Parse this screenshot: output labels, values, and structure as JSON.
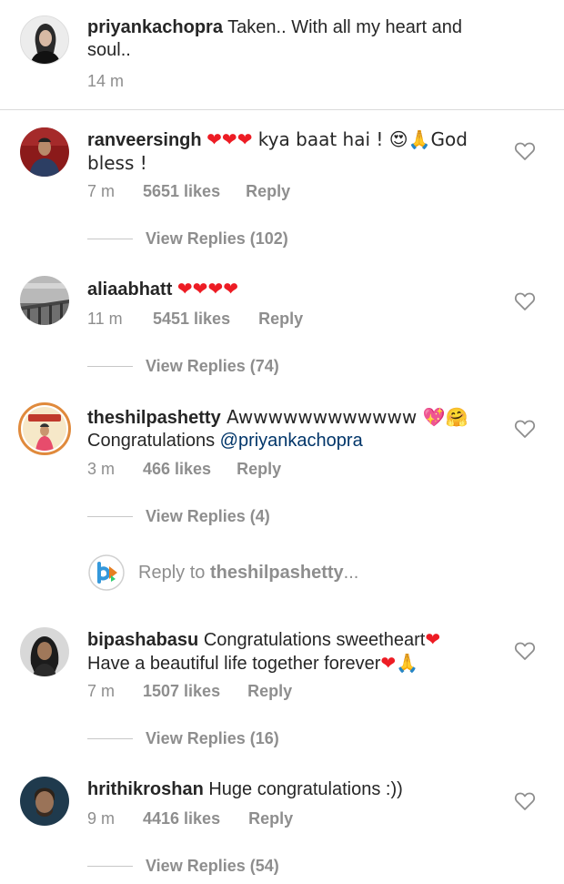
{
  "caption": {
    "username": "priyankachopra",
    "text": " Taken.. With all my heart and soul..",
    "time": "14 m"
  },
  "comments": [
    {
      "username": "ranveersingh",
      "text_before": " ",
      "hearts": "❤❤❤",
      "text_after": " kya baat hai ! 😍🙏God bless !",
      "time": "7 m",
      "likes": "5651 likes",
      "reply": "Reply",
      "view_replies": "View Replies (102)"
    },
    {
      "username": "aliaabhatt",
      "text_before": " ",
      "hearts": "❤❤❤❤",
      "text_after": "",
      "time": "11 m",
      "likes": "5451 likes",
      "reply": "Reply",
      "view_replies": "View Replies (74)"
    },
    {
      "username": "theshilpashetty",
      "text_before": " Awwwwwwwwwwww 💖🤗",
      "line2_prefix": "Congratulations ",
      "mention": "@priyankachopra",
      "time": "3 m",
      "likes": "466 likes",
      "reply": "Reply",
      "view_replies": "View Replies (4)"
    },
    {
      "username": "bipashabasu",
      "text_before": " Congratulations sweetheart",
      "heart1": "❤",
      "line2": "Have a beautiful life together forever",
      "heart2": "❤",
      "line2_end": "🙏",
      "time": "7 m",
      "likes": "1507 likes",
      "reply": "Reply",
      "view_replies": "View Replies (16)"
    },
    {
      "username": "hrithikroshan",
      "text_before": " Huge congratulations :))",
      "time": "9 m",
      "likes": "4416 likes",
      "reply": "Reply",
      "view_replies": "View Replies (54)"
    }
  ],
  "reply_to": {
    "prefix": "Reply to ",
    "username": "theshilpashetty",
    "suffix": "..."
  },
  "colors": {
    "text": "#262626",
    "meta": "#8e8e8e",
    "mention": "#003569",
    "heart": "#ed1c24"
  },
  "icons": [
    "like-heart-icon",
    "reply-logo-icon"
  ]
}
